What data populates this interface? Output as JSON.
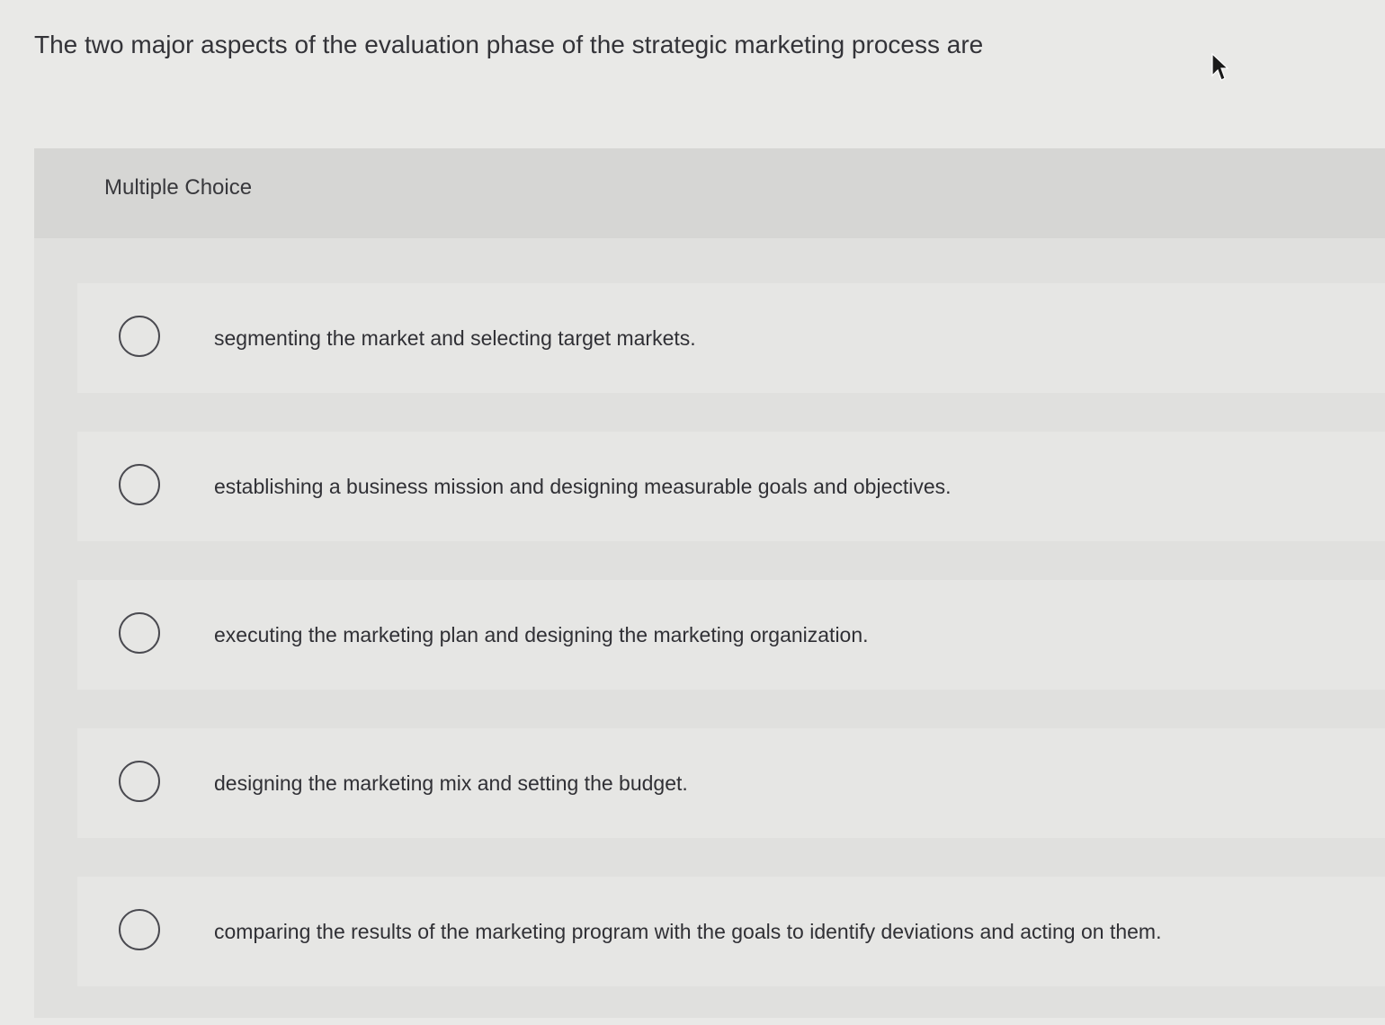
{
  "question": {
    "text": "The two major aspects of the evaluation phase of the strategic marketing process are"
  },
  "panel": {
    "header_label": "Multiple Choice"
  },
  "options": [
    {
      "label": "segmenting the market and selecting target markets."
    },
    {
      "label": "establishing a business mission and designing measurable goals and objectives."
    },
    {
      "label": "executing the marketing plan and designing the marketing organization."
    },
    {
      "label": "designing the marketing mix and setting the budget."
    },
    {
      "label": "comparing the results of the marketing program with the goals to identify deviations and acting on them."
    }
  ],
  "icons": {
    "cursor": "mouse-pointer-icon",
    "option_radio": "radio-unselected-icon"
  },
  "colors": {
    "background": "#e9e9e7",
    "panel": "#e0e0de",
    "panel_header": "#d6d6d4",
    "option_row": "#e6e6e4",
    "text": "#303035"
  }
}
